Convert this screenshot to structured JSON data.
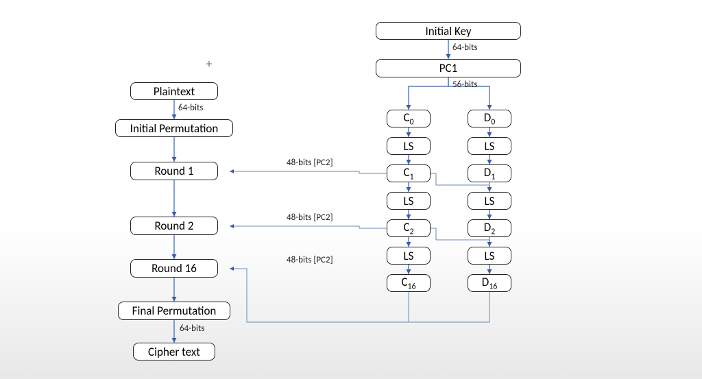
{
  "left": {
    "plaintext": "Plaintext",
    "bits64_1": "64-bits",
    "init_perm": "Initial Permutation",
    "round1": "Round 1",
    "round2": "Round 2",
    "round16": "Round 16",
    "final_perm": "Final Permutation",
    "bits64_2": "64-bits",
    "cipher": "Cipher text",
    "pc2_1": "48-bits  [PC2]",
    "pc2_2": "48-bits  [PC2]",
    "pc2_3": "48-bits  [PC2]"
  },
  "right": {
    "init_key": "Initial Key",
    "bits64": "64-bits",
    "pc1": "PC1",
    "bits56": "56-bits",
    "C0": "C<sub>0</sub>",
    "D0": "D<sub>0</sub>",
    "LS": "LS",
    "C1": "C<sub>1</sub>",
    "D1": "D<sub>1</sub>",
    "C2": "C<sub>2</sub>",
    "D2": "D<sub>2</sub>",
    "C16": "C<sub>16</sub>",
    "D16": "D<sub>16</sub>"
  },
  "chart_data": {
    "type": "diagram",
    "title": "DES (Data Encryption Standard) structure",
    "encryption_path": {
      "nodes": [
        "Plaintext",
        "Initial Permutation",
        "Round 1",
        "Round 2",
        "Round 16",
        "Final Permutation",
        "Cipher text"
      ],
      "edges": [
        {
          "from": "Plaintext",
          "to": "Initial Permutation",
          "label": "64-bits"
        },
        {
          "from": "Initial Permutation",
          "to": "Round 1"
        },
        {
          "from": "Round 1",
          "to": "Round 2"
        },
        {
          "from": "Round 2",
          "to": "Round 16",
          "ellipsis": true
        },
        {
          "from": "Round 16",
          "to": "Final Permutation"
        },
        {
          "from": "Final Permutation",
          "to": "Cipher text",
          "label": "64-bits"
        }
      ]
    },
    "key_schedule": {
      "nodes": [
        "Initial Key",
        "PC1",
        "C0",
        "D0",
        "LS",
        "C1",
        "D1",
        "LS",
        "C2",
        "D2",
        "LS",
        "C16",
        "D16"
      ],
      "edges": [
        {
          "from": "Initial Key",
          "to": "PC1",
          "label": "64-bits"
        },
        {
          "from": "PC1",
          "to": [
            "C0",
            "D0"
          ],
          "label": "56-bits"
        },
        {
          "from": "C0",
          "to": "LS"
        },
        {
          "from": "LS",
          "to": "C1"
        },
        {
          "from": "D0",
          "to": "LS"
        },
        {
          "from": "LS",
          "to": "D1"
        },
        {
          "from": "C1",
          "to": "LS"
        },
        {
          "from": "LS",
          "to": "C2"
        },
        {
          "from": "D1",
          "to": "LS"
        },
        {
          "from": "LS",
          "to": "D2"
        },
        {
          "from": "C2",
          "to": "LS"
        },
        {
          "from": "LS",
          "to": "C16"
        },
        {
          "from": "D2",
          "to": "LS"
        },
        {
          "from": "LS",
          "to": "D16"
        }
      ]
    },
    "round_key_inputs": [
      {
        "from": [
          "C1",
          "D1"
        ],
        "via": "PC2",
        "bits": 48,
        "to": "Round 1"
      },
      {
        "from": [
          "C2",
          "D2"
        ],
        "via": "PC2",
        "bits": 48,
        "to": "Round 2"
      },
      {
        "from": [
          "C16",
          "D16"
        ],
        "via": "PC2",
        "bits": 48,
        "to": "Round 16"
      }
    ]
  }
}
